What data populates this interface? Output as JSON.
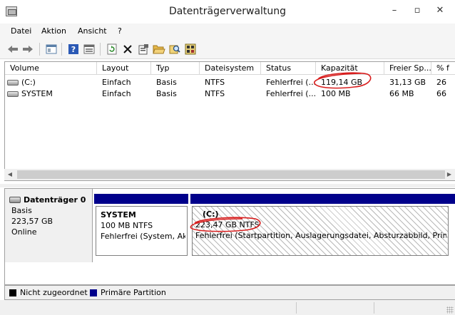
{
  "window": {
    "title": "Datenträgerverwaltung",
    "icon": "disk-management-icon",
    "controls": [
      "–",
      "▫",
      "✕"
    ]
  },
  "menu": [
    "Datei",
    "Aktion",
    "Ansicht",
    "?"
  ],
  "toolbar": {
    "buttons": [
      "back-icon",
      "forward-icon",
      "properties-icon",
      "help-icon",
      "view-icon",
      "refresh-icon",
      "delete-icon",
      "properties-sheet-icon",
      "open-folder-icon",
      "explore-icon",
      "check-disk-icon"
    ]
  },
  "volume_table": {
    "columns": [
      "Volume",
      "Layout",
      "Typ",
      "Dateisystem",
      "Status",
      "Kapazität",
      "Freier Sp...",
      "% f"
    ],
    "rows": [
      [
        "(C:)",
        "Einfach",
        "Basis",
        "NTFS",
        "Fehlerfrei (...",
        "119,14 GB",
        "31,13 GB",
        "26"
      ],
      [
        "SYSTEM",
        "Einfach",
        "Basis",
        "NTFS",
        "Fehlerfrei (...",
        "100 MB",
        "66 MB",
        "66"
      ]
    ]
  },
  "disk": {
    "name": "Datenträger 0",
    "type": "Basis",
    "size": "223,57 GB",
    "state": "Online",
    "partitions": [
      {
        "name": "SYSTEM",
        "size": "100 MB NTFS",
        "status": "Fehlerfrei (System, Akt"
      },
      {
        "name": "(C:)",
        "size": "223,47 GB NTFS",
        "status": "Fehlerfrei (Startpartition, Auslagerungsdatei, Absturzabbild, Primä"
      }
    ]
  },
  "legend": [
    {
      "label": "Nicht zugeordnet",
      "color": "#000000"
    },
    {
      "label": "Primäre Partition",
      "color": "#00008b"
    }
  ],
  "annotation_color": "#d81e1e"
}
